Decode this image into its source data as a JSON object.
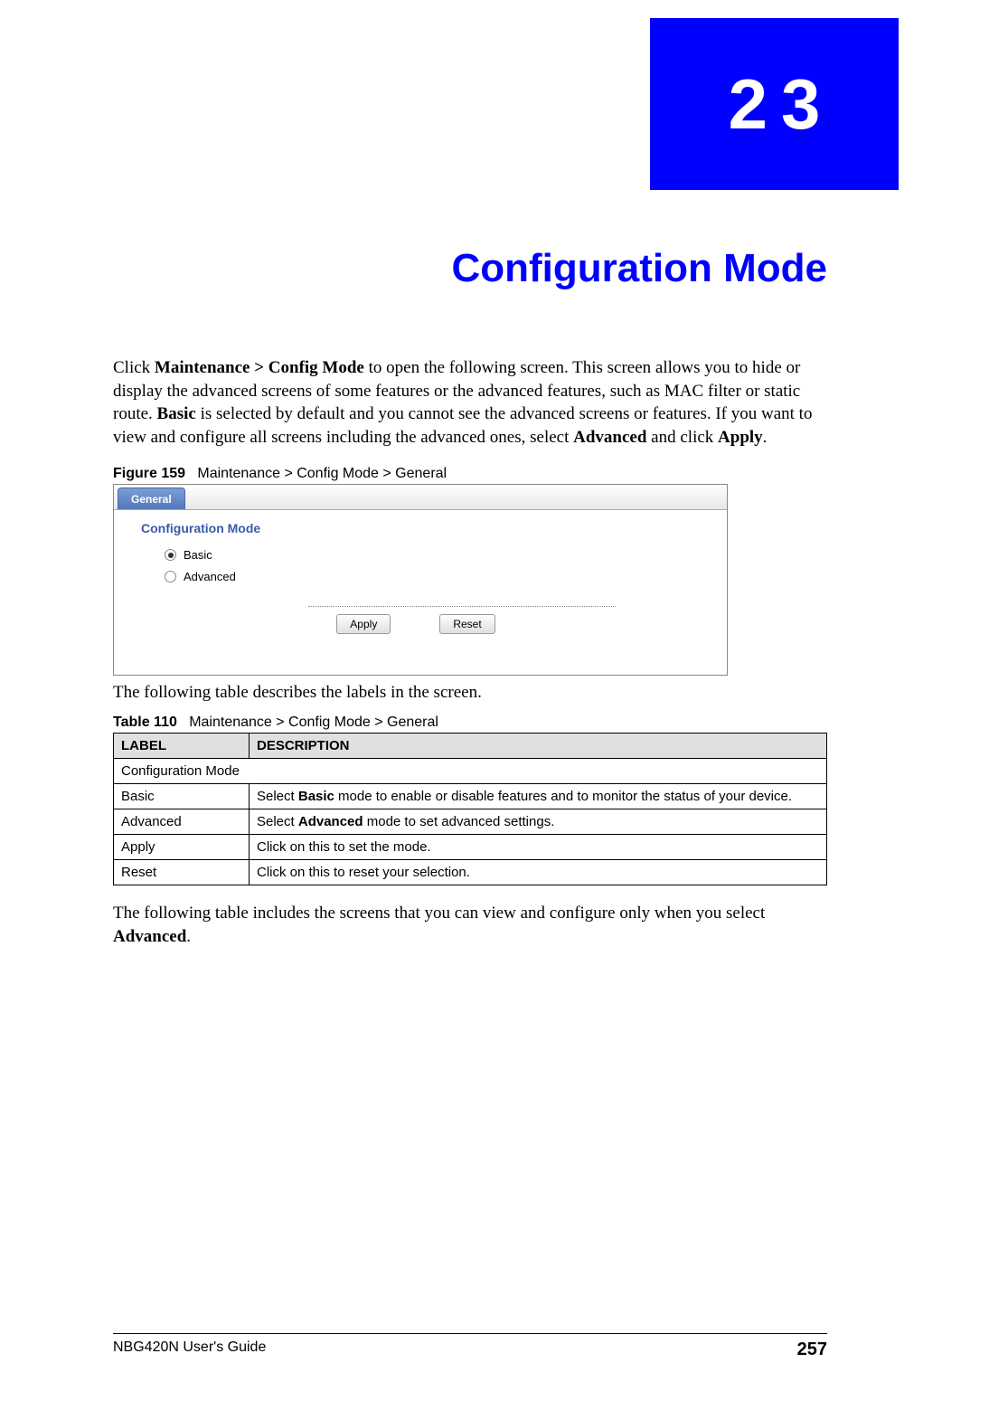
{
  "chapter_number": "23",
  "chapter_title": "Configuration Mode",
  "intro_segments": [
    "Click ",
    {
      "bold": "Maintenance > Config Mode"
    },
    " to open the following screen. This screen allows you to hide or display the advanced screens of some features or the advanced features, such as MAC filter or static route. ",
    {
      "bold": "Basic"
    },
    " is selected by default and you cannot see the advanced screens or features. If you want to view and configure all screens including the advanced ones, select ",
    {
      "bold": "Advanced"
    },
    " and click ",
    {
      "bold": "Apply"
    },
    "."
  ],
  "figure_label": "Figure 159",
  "figure_caption": "Maintenance > Config Mode > General",
  "screenshot": {
    "tab_label": "General",
    "panel_heading": "Configuration Mode",
    "radios": [
      {
        "label": "Basic",
        "checked": true
      },
      {
        "label": "Advanced",
        "checked": false
      }
    ],
    "apply_button": "Apply",
    "reset_button": "Reset"
  },
  "after_figure_text": "The following table describes the labels in the screen.",
  "table_label": "Table 110",
  "table_caption": "Maintenance > Config Mode > General",
  "table_headers": [
    "LABEL",
    "DESCRIPTION"
  ],
  "table_rows": [
    {
      "label": "Configuration Mode",
      "description": "",
      "span": true
    },
    {
      "label": "Basic",
      "desc_pre": "Select ",
      "desc_bold": "Basic",
      "desc_post": " mode to enable or disable features and to monitor the status of your device."
    },
    {
      "label": "Advanced",
      "desc_pre": "Select ",
      "desc_bold": "Advanced",
      "desc_post": " mode to set advanced settings."
    },
    {
      "label": "Apply",
      "desc_pre": "Click on this to set the mode.",
      "desc_bold": "",
      "desc_post": ""
    },
    {
      "label": "Reset",
      "desc_pre": "Click on this to reset your selection.",
      "desc_bold": "",
      "desc_post": ""
    }
  ],
  "after_table_pre": "The following table includes the screens that you can view and configure only when you select ",
  "after_table_bold": "Advanced",
  "after_table_post": ".",
  "footer_guide": "NBG420N User's Guide",
  "page_number": "257"
}
